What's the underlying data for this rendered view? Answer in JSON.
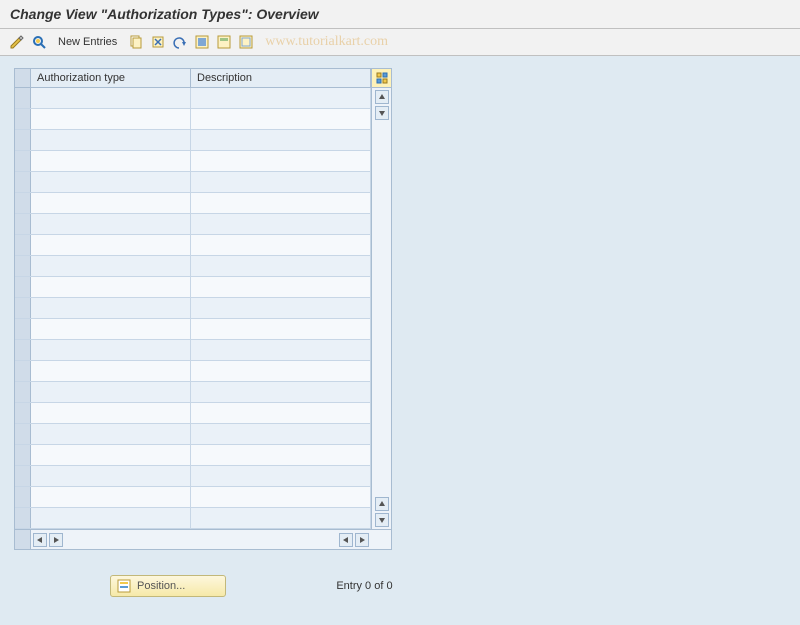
{
  "title": "Change View \"Authorization Types\": Overview",
  "toolbar": {
    "new_entries_label": "New Entries"
  },
  "watermark": "www.tutorialkart.com",
  "grid": {
    "columns": {
      "authorization_type": "Authorization type",
      "description": "Description"
    },
    "rows": [
      {
        "authorization_type": "",
        "description": ""
      },
      {
        "authorization_type": "",
        "description": ""
      },
      {
        "authorization_type": "",
        "description": ""
      },
      {
        "authorization_type": "",
        "description": ""
      },
      {
        "authorization_type": "",
        "description": ""
      },
      {
        "authorization_type": "",
        "description": ""
      },
      {
        "authorization_type": "",
        "description": ""
      },
      {
        "authorization_type": "",
        "description": ""
      },
      {
        "authorization_type": "",
        "description": ""
      },
      {
        "authorization_type": "",
        "description": ""
      },
      {
        "authorization_type": "",
        "description": ""
      },
      {
        "authorization_type": "",
        "description": ""
      },
      {
        "authorization_type": "",
        "description": ""
      },
      {
        "authorization_type": "",
        "description": ""
      },
      {
        "authorization_type": "",
        "description": ""
      },
      {
        "authorization_type": "",
        "description": ""
      },
      {
        "authorization_type": "",
        "description": ""
      },
      {
        "authorization_type": "",
        "description": ""
      },
      {
        "authorization_type": "",
        "description": ""
      },
      {
        "authorization_type": "",
        "description": ""
      },
      {
        "authorization_type": "",
        "description": ""
      }
    ]
  },
  "footer": {
    "position_label": "Position...",
    "entry_status": "Entry 0 of 0"
  }
}
